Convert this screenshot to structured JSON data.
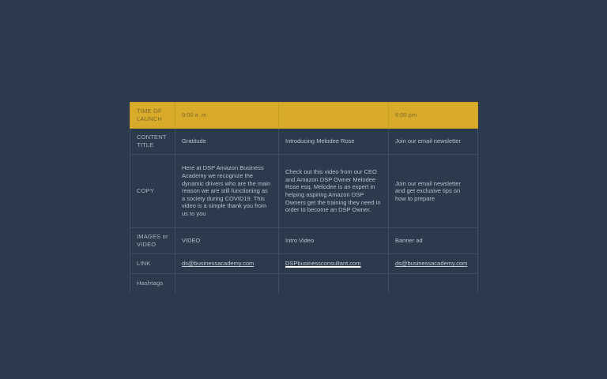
{
  "table": {
    "header": {
      "label": "TIME OF LAUNCH",
      "cells": [
        "9:00 a .m",
        "",
        "6:00 pm"
      ]
    },
    "content_title": {
      "label": "CONTENT TITLE",
      "cells": [
        "Gratitude",
        "Introducing Melodee Rose",
        "Join our email newsletter"
      ]
    },
    "copy": {
      "label": "COPY",
      "cells": [
        "Here at DSP Amazon Business Academy we recognize the dynamic drivers who are the main reason we are still functioning as a society during COVID19. This video is a simple thank you from us to you",
        "Check out this video from our CEO and Amazon DSP Owner Melodee Rose esq. Melodee is an expert in helping aspiring Amazon DSP Owners get the training they need in order to become an DSP Owner.",
        "Join our email newsletter and get exclusive tips on how to prepare"
      ]
    },
    "images": {
      "label": "IMAGES or VIDEO",
      "cells": [
        "VIDEO",
        "Intro Video",
        "Banner ad"
      ]
    },
    "link": {
      "label": "LINK",
      "cells": [
        "ds@businessacademy.com",
        "DSPbusinessconsultant.com",
        "ds@businessacademy.com"
      ]
    },
    "hashtags": {
      "label": "Hashtags",
      "cells": [
        "",
        "",
        ""
      ]
    }
  },
  "colors": {
    "background": "#2b3a4c",
    "header_fill": "#d8ab2a",
    "grid_line": "#3e4f62",
    "text": "#b8c2cd"
  }
}
